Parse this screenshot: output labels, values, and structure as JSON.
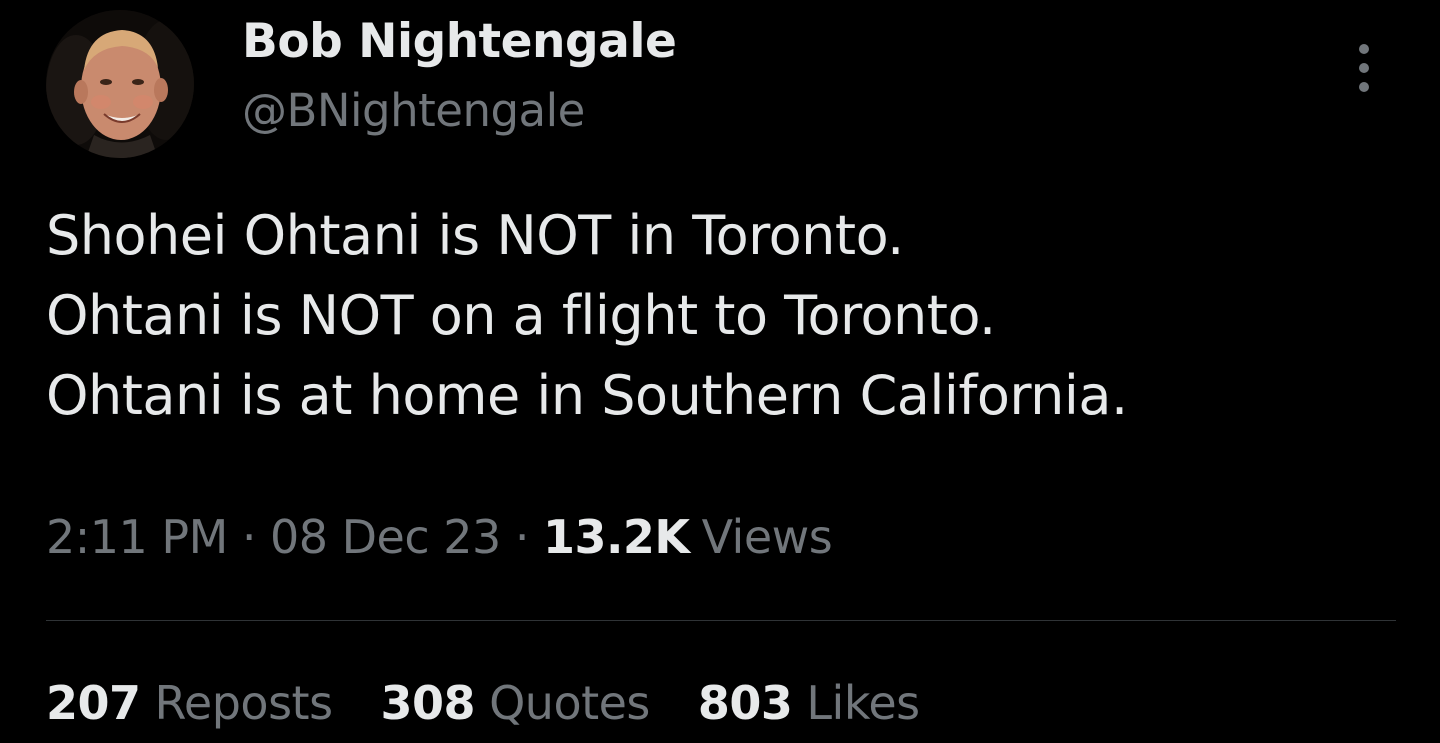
{
  "author": {
    "display_name": "Bob Nightengale",
    "handle": "@BNightengale",
    "avatar_icon": "profile-photo"
  },
  "tweet": {
    "lines": [
      "Shohei Ohtani is NOT in Toronto.",
      "Ohtani is NOT on a flight to Toronto.",
      "Ohtani is at home in Southern California."
    ]
  },
  "meta": {
    "time": "2:11 PM",
    "separator": "·",
    "date": "08 Dec 23",
    "views_count": "13.2K",
    "views_label": "Views"
  },
  "stats": {
    "reposts_count": "207",
    "reposts_label": "Reposts",
    "quotes_count": "308",
    "quotes_label": "Quotes",
    "likes_count": "803",
    "likes_label": "Likes"
  },
  "colors": {
    "background": "#000000",
    "primary_text": "#e7e9ea",
    "secondary_text": "#71767b",
    "divider": "#2f3336"
  }
}
